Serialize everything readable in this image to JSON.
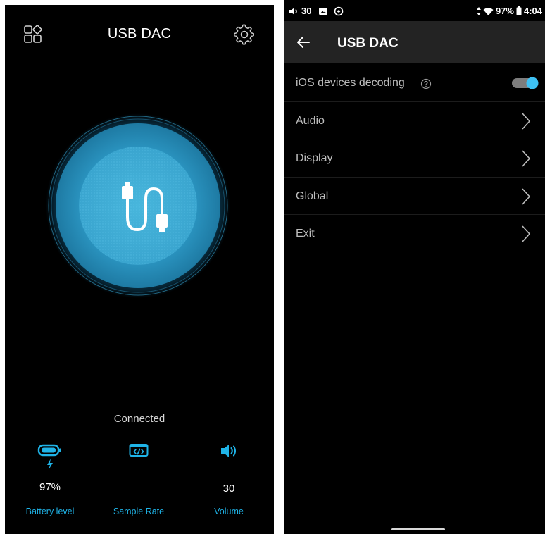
{
  "left_screen": {
    "title": "USB DAC",
    "connection_status": "Connected",
    "stats": {
      "battery": {
        "value": "97%",
        "label": "Battery level"
      },
      "sample_rate": {
        "label": "Sample Rate"
      },
      "volume": {
        "value": "30",
        "label": "Volume"
      }
    },
    "icons": [
      "apps-icon",
      "gear-icon",
      "usb-cable-icon",
      "battery-icon",
      "charging-bolt-icon",
      "code-icon",
      "speaker-icon"
    ],
    "accent_color": "#1fb4e8"
  },
  "right_screen": {
    "status_bar": {
      "volume_level": "30",
      "battery": "97%",
      "time": "4:04"
    },
    "title": "USB DAC",
    "menu": {
      "ios_decoding": {
        "label": "iOS devices decoding",
        "enabled": true
      },
      "items": [
        {
          "label": "Audio"
        },
        {
          "label": "Display"
        },
        {
          "label": "Global"
        },
        {
          "label": "Exit"
        }
      ]
    },
    "icons": [
      "speaker-icon",
      "image-icon",
      "sync-icon",
      "data-arrows-icon",
      "wifi-icon",
      "battery-icon",
      "back-arrow-icon",
      "help-icon",
      "chevron-right-icon"
    ],
    "toggle_color": "#3ec1f3"
  }
}
